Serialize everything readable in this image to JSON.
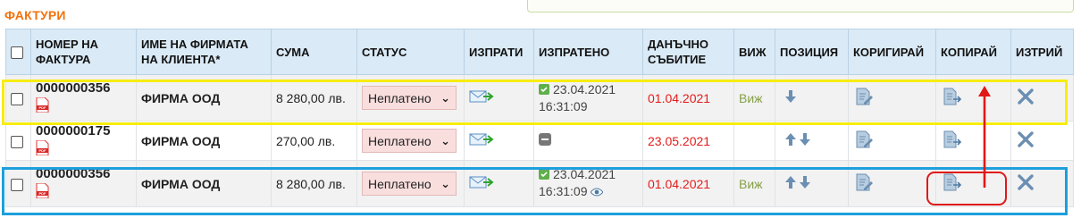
{
  "section": {
    "title": "ФАКТУРИ"
  },
  "table": {
    "headers": {
      "number": "НОМЕР НА ФАКТУРА",
      "company": "ИМЕ НА ФИРМАТА НА КЛИЕНТА*",
      "amount": "СУМА",
      "status": "СТАТУС",
      "send": "ИЗПРАТИ",
      "sent": "ИЗПРАТЕНО",
      "tax_event": "ДАНЪЧНО СЪБИТИЕ",
      "view": "ВИЖ",
      "position": "ПОЗИЦИЯ",
      "edit": "КОРИГИРАЙ",
      "copy": "КОПИРАЙ",
      "delete": "ИЗТРИЙ"
    },
    "rows": [
      {
        "number": "0000000356",
        "company": "ФИРМА ООД",
        "amount": "8 280,00 лв.",
        "status": "Неплатено",
        "sent_date": "23.04.2021",
        "sent_time": "16:31:09",
        "tax_date": "01.04.2021",
        "view": "Виж"
      },
      {
        "number": "0000000175",
        "company": "ФИРМА ООД",
        "amount": "270,00 лв.",
        "status": "Неплатено",
        "sent_date": "",
        "sent_time": "",
        "tax_date": "23.05.2021",
        "view": ""
      },
      {
        "number": "0000000356",
        "company": "ФИРМА ООД",
        "amount": "8 280,00 лв.",
        "status": "Неплатено",
        "sent_date": "23.04.2021",
        "sent_time": "16:31:09",
        "tax_date": "01.04.2021",
        "view": "Виж"
      }
    ]
  },
  "colors": {
    "title": "#f2720c",
    "header_bg": "#daeaf6",
    "status_bg": "#f9dede",
    "tax_date": "#e41b1b",
    "view_link": "#86a046",
    "highlight_yellow": "#f7ec12",
    "highlight_blue": "#1d9fdc",
    "highlight_red": "#e11818"
  },
  "icons": {
    "pdf": "pdf-icon",
    "send": "send-mail-icon",
    "sent": "sent-check-icon",
    "not_sent": "not-sent-icon",
    "seen": "eye-icon",
    "up": "arrow-up-icon",
    "down": "arrow-down-icon",
    "edit": "edit-document-icon",
    "copy": "copy-document-icon",
    "delete": "delete-x-icon"
  }
}
